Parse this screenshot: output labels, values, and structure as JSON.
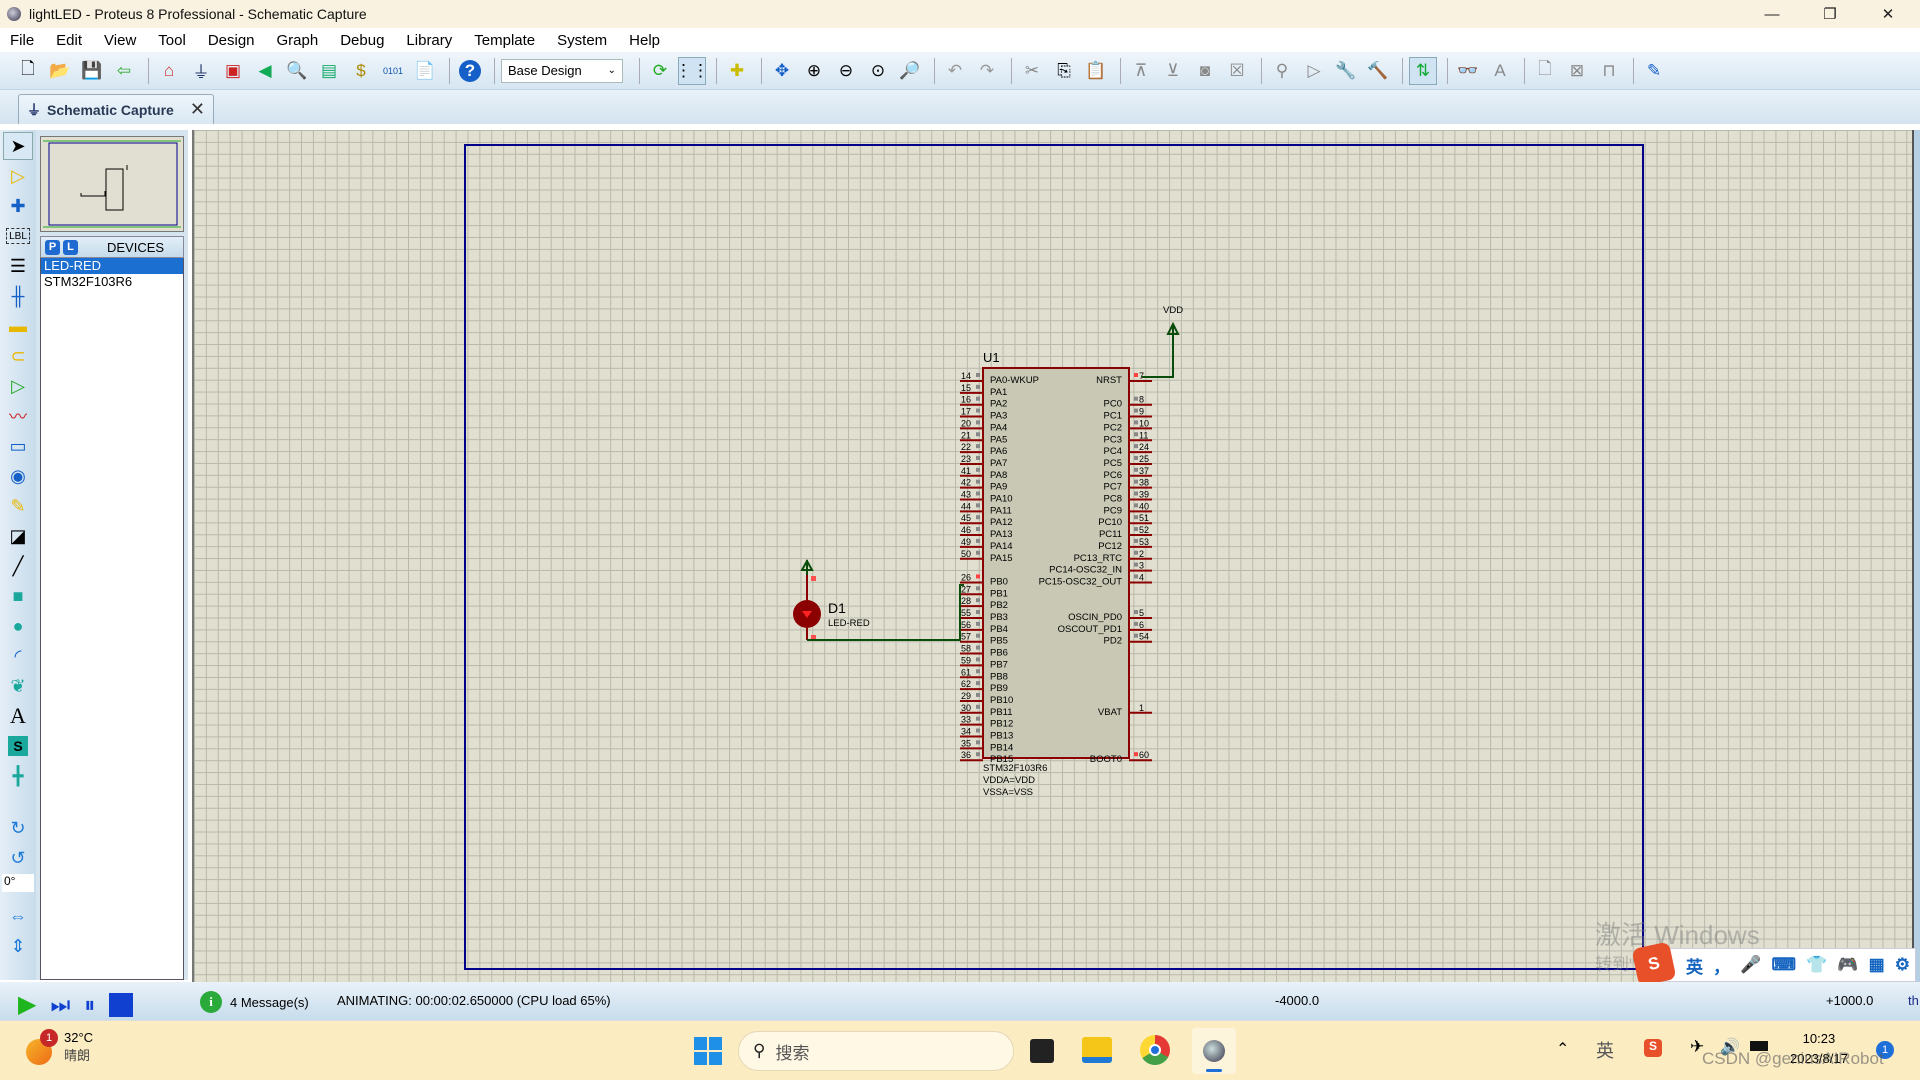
{
  "window": {
    "title": "lightLED - Proteus 8 Professional - Schematic Capture",
    "minimize": "—",
    "restore": "❐",
    "close": "✕"
  },
  "menu": [
    "File",
    "Edit",
    "View",
    "Tool",
    "Design",
    "Graph",
    "Debug",
    "Library",
    "Template",
    "System",
    "Help"
  ],
  "toolbar": {
    "design_select": "Base Design",
    "icons": [
      "new-file",
      "open-file",
      "save",
      "import",
      "home",
      "schematic",
      "pcb",
      "3d",
      "gerber",
      "bom",
      "binary",
      "document",
      "help",
      "refresh",
      "grid",
      "origin",
      "pan",
      "zoom-in",
      "zoom-out",
      "zoom-all",
      "zoom-area",
      "undo",
      "redo",
      "cut",
      "copy",
      "paste",
      "block-copy",
      "block-move",
      "block-rotate",
      "block-delete",
      "pick",
      "make-device",
      "packaging",
      "decompose",
      "wire-autorouter",
      "search",
      "property-assign",
      "new-sheet",
      "remove-sheet",
      "goto-sheet",
      "netlist"
    ]
  },
  "tab": {
    "label": "Schematic Capture",
    "close": "✕"
  },
  "devices_panel": {
    "p_label": "P",
    "l_label": "L",
    "title": "DEVICES",
    "items": [
      "LED-RED",
      "STM32F103R6"
    ],
    "selected": "LED-RED"
  },
  "rotation": "0°",
  "schematic": {
    "u1": {
      "ref": "U1",
      "part": "STM32F103R6",
      "props": [
        "VDDA=VDD",
        "VSSA=VSS"
      ],
      "left_pins": [
        [
          "14",
          "PA0-WKUP"
        ],
        [
          "15",
          "PA1"
        ],
        [
          "16",
          "PA2"
        ],
        [
          "17",
          "PA3"
        ],
        [
          "20",
          "PA4"
        ],
        [
          "21",
          "PA5"
        ],
        [
          "22",
          "PA6"
        ],
        [
          "23",
          "PA7"
        ],
        [
          "41",
          "PA8"
        ],
        [
          "42",
          "PA9"
        ],
        [
          "43",
          "PA10"
        ],
        [
          "44",
          "PA11"
        ],
        [
          "45",
          "PA12"
        ],
        [
          "46",
          "PA13"
        ],
        [
          "49",
          "PA14"
        ],
        [
          "50",
          "PA15"
        ],
        [
          "",
          ""
        ],
        [
          "26",
          "PB0"
        ],
        [
          "27",
          "PB1"
        ],
        [
          "28",
          "PB2"
        ],
        [
          "55",
          "PB3"
        ],
        [
          "56",
          "PB4"
        ],
        [
          "57",
          "PB5"
        ],
        [
          "58",
          "PB6"
        ],
        [
          "59",
          "PB7"
        ],
        [
          "61",
          "PB8"
        ],
        [
          "62",
          "PB9"
        ],
        [
          "29",
          "PB10"
        ],
        [
          "30",
          "PB11"
        ],
        [
          "33",
          "PB12"
        ],
        [
          "34",
          "PB13"
        ],
        [
          "35",
          "PB14"
        ],
        [
          "36",
          "PB15"
        ]
      ],
      "right_pins": [
        [
          "7",
          "NRST"
        ],
        [
          "",
          ""
        ],
        [
          "8",
          "PC0"
        ],
        [
          "9",
          "PC1"
        ],
        [
          "10",
          "PC2"
        ],
        [
          "11",
          "PC3"
        ],
        [
          "24",
          "PC4"
        ],
        [
          "25",
          "PC5"
        ],
        [
          "37",
          "PC6"
        ],
        [
          "38",
          "PC7"
        ],
        [
          "39",
          "PC8"
        ],
        [
          "40",
          "PC9"
        ],
        [
          "51",
          "PC10"
        ],
        [
          "52",
          "PC11"
        ],
        [
          "53",
          "PC12"
        ],
        [
          "2",
          "PC13_RTC"
        ],
        [
          "3",
          "PC14-OSC32_IN"
        ],
        [
          "4",
          "PC15-OSC32_OUT"
        ],
        [
          "",
          ""
        ],
        [
          "",
          ""
        ],
        [
          "5",
          "OSCIN_PD0"
        ],
        [
          "6",
          "OSCOUT_PD1"
        ],
        [
          "54",
          "PD2"
        ],
        [
          "",
          ""
        ],
        [
          "",
          ""
        ],
        [
          "",
          ""
        ],
        [
          "",
          ""
        ],
        [
          "",
          ""
        ],
        [
          "1",
          "VBAT"
        ],
        [
          "",
          ""
        ],
        [
          "",
          ""
        ],
        [
          "",
          ""
        ],
        [
          "60",
          "BOOT0"
        ]
      ]
    },
    "d1": {
      "ref": "D1",
      "part": "LED-RED"
    },
    "power_label": "VDD"
  },
  "status": {
    "messages": "4 Message(s)",
    "animation": "ANIMATING: 00:00:02.650000 (CPU load 65%)",
    "coord_x": "-4000.0",
    "coord_y": "+1000.0",
    "units": "th"
  },
  "watermark": {
    "line1": "激活 Windows",
    "line2": "转到\"设置\"以激活 Windows。"
  },
  "ime_bar": [
    "英",
    "，",
    "🎤",
    "⌨",
    "👕",
    "🎮",
    "▦",
    "⚙"
  ],
  "taskbar": {
    "weather_temp": "32°C",
    "weather_desc": "晴朗",
    "weather_badge": "1",
    "search_placeholder": "搜索",
    "tray_ime": "英",
    "time": "10:23",
    "date": "2023/8/17",
    "notif": "1",
    "csdn": "CSDN @geniusAIRobot"
  }
}
